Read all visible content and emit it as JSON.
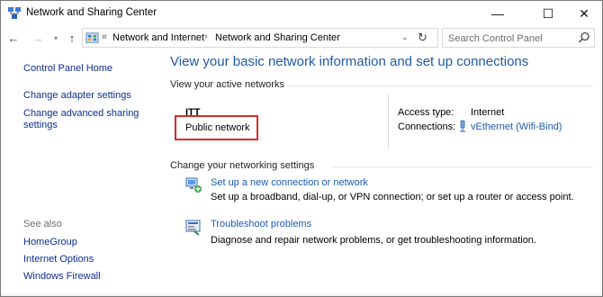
{
  "window": {
    "title": "Network and Sharing Center",
    "controls": {
      "minimize": "—",
      "maximize": "☐",
      "close": "✕"
    }
  },
  "nav": {
    "back": "←",
    "forward": "→",
    "recent": "▾",
    "up": "↑",
    "address_prefix": "«",
    "breadcrumbs": [
      "Network and Internet",
      "Network and Sharing Center"
    ],
    "crumb_separator": "›",
    "dropdown": "⌄",
    "refresh": "↻",
    "search_placeholder": "Search Control Panel"
  },
  "sidebar": {
    "links": [
      {
        "label": "Control Panel Home"
      },
      {
        "label": "Change adapter settings"
      },
      {
        "label": "Change advanced sharing\nsettings",
        "line1": "Change advanced sharing",
        "line2": "settings"
      }
    ],
    "see_also_heading": "See also",
    "see_also": [
      {
        "label": "HomeGroup"
      },
      {
        "label": "Internet Options"
      },
      {
        "label": "Windows Firewall"
      }
    ]
  },
  "main": {
    "title": "View your basic network information and set up connections",
    "active_networks_label": "View your active networks",
    "network": {
      "name": "ITT",
      "type": "Public network",
      "access_type_label": "Access type:",
      "access_type_value": "Internet",
      "connections_label": "Connections:",
      "connection_name": "vEthernet (Wifi-Bind)"
    },
    "change_settings_label": "Change your networking settings",
    "tasks": [
      {
        "link": "Set up a new connection or network",
        "description": "Set up a broadband, dial-up, or VPN connection; or set up a router or access point.",
        "icon": "new-connection-icon"
      },
      {
        "link": "Troubleshoot problems",
        "description": "Diagnose and repair network problems, or get troubleshooting information.",
        "icon": "troubleshoot-icon"
      }
    ]
  },
  "colors": {
    "link": "#1a5bb5",
    "sidebar_link": "#0b2f8f",
    "title": "#1e5aa8",
    "highlight": "#d72b2b"
  }
}
